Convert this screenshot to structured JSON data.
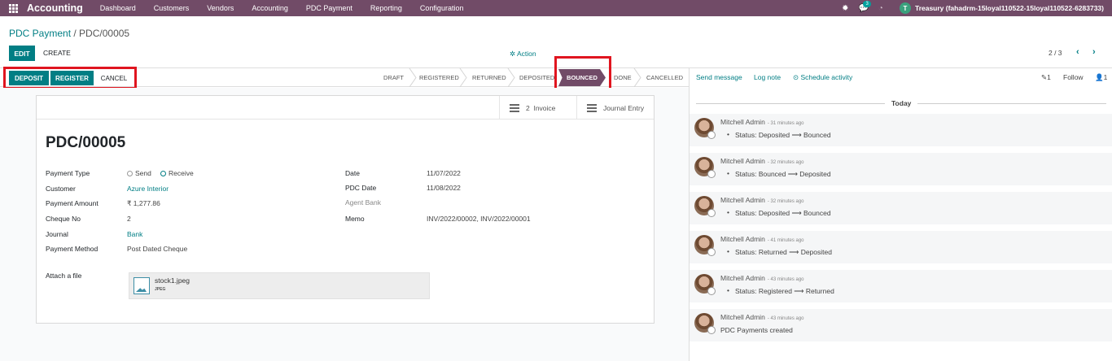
{
  "navbar": {
    "brand": "Accounting",
    "menu": [
      "Dashboard",
      "Customers",
      "Vendors",
      "Accounting",
      "PDC Payment",
      "Reporting",
      "Configuration"
    ],
    "messages_badge": "3",
    "user_initial": "T",
    "company": "Treasury (fahadrm-15loyal110522-15loyal110522-6283733)"
  },
  "breadcrumb": {
    "parent": "PDC Payment",
    "separator": " / ",
    "current": "PDC/00005"
  },
  "controls": {
    "edit": "EDIT",
    "create": "CREATE",
    "action": "✲ Action",
    "pager": "2 / 3",
    "prev": "‹",
    "next": "›"
  },
  "header_buttons": {
    "deposit": "DEPOSIT",
    "register": "REGISTER",
    "cancel": "CANCEL"
  },
  "stages": {
    "draft": "DRAFT",
    "registered": "REGISTERED",
    "returned": "RETURNED",
    "deposited": "DEPOSITED",
    "bounced": "BOUNCED",
    "done": "DONE",
    "cancelled": "CANCELLED",
    "active": "BOUNCED"
  },
  "smart_buttons": {
    "invoice_count": "2",
    "invoice_label": "Invoice",
    "journal_entry": "Journal Entry"
  },
  "record": {
    "title": "PDC/00005",
    "payment_type_label": "Payment Type",
    "payment_type_options": [
      "Send",
      "Receive"
    ],
    "payment_type_selected": "Receive",
    "customer_label": "Customer",
    "customer": "Azure Interior",
    "amount_label": "Payment Amount",
    "amount": "₹ 1,277.86",
    "cheque_label": "Cheque No",
    "cheque": "2",
    "journal_label": "Journal",
    "journal": "Bank",
    "method_label": "Payment Method",
    "method": "Post Dated Cheque",
    "date_label": "Date",
    "date": "11/07/2022",
    "pdc_date_label": "PDC Date",
    "pdc_date": "11/08/2022",
    "agent_bank_label": "Agent Bank",
    "memo_label": "Memo",
    "memo": "INV/2022/00002, INV/2022/00001",
    "attach_label": "Attach a file",
    "file_name": "stock1.jpeg",
    "file_type": "JPEG"
  },
  "chatter": {
    "send_message": "Send message",
    "log_note": "Log note",
    "schedule_activity": "⊙ Schedule activity",
    "attachments": "✎1",
    "follow": "Follow",
    "followers": "👤1",
    "today": "Today",
    "messages": [
      {
        "author": "Mitchell Admin",
        "time": "- 31 minutes ago",
        "body": "Status: Deposited ⟶ Bounced"
      },
      {
        "author": "Mitchell Admin",
        "time": "- 32 minutes ago",
        "body": "Status: Bounced ⟶ Deposited"
      },
      {
        "author": "Mitchell Admin",
        "time": "- 32 minutes ago",
        "body": "Status: Deposited ⟶ Bounced"
      },
      {
        "author": "Mitchell Admin",
        "time": "- 41 minutes ago",
        "body": "Status: Returned ⟶ Deposited"
      },
      {
        "author": "Mitchell Admin",
        "time": "- 43 minutes ago",
        "body": "Status: Registered ⟶ Returned"
      },
      {
        "author": "Mitchell Admin",
        "time": "- 43 minutes ago",
        "body": "PDC Payments created"
      }
    ]
  },
  "colors": {
    "brand": "#714b67",
    "accent": "#017e84",
    "highlight": "#e0151f"
  }
}
